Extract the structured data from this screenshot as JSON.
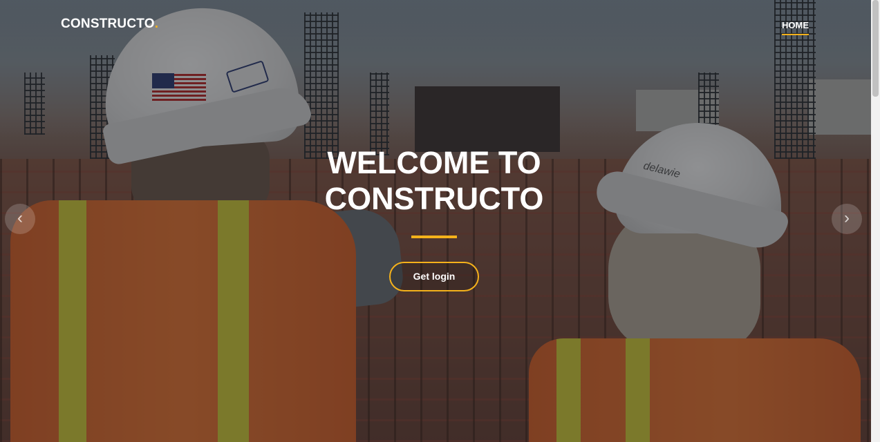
{
  "header": {
    "logo_text": "CONSTRUCTO",
    "logo_dot": ".",
    "nav": [
      {
        "label": "HOME",
        "active": true
      }
    ]
  },
  "hero": {
    "title_line1": "WELCOME TO",
    "title_line2": "CONSTRUCTO",
    "cta_label": "Get login"
  },
  "carousel": {
    "prev_icon": "chevron-left-icon",
    "next_icon": "chevron-right-icon"
  },
  "scene": {
    "hat_text": "delawie"
  },
  "colors": {
    "accent": "#f5b21b",
    "text": "#ffffff",
    "overlay": "rgba(20,22,28,0.48)"
  }
}
